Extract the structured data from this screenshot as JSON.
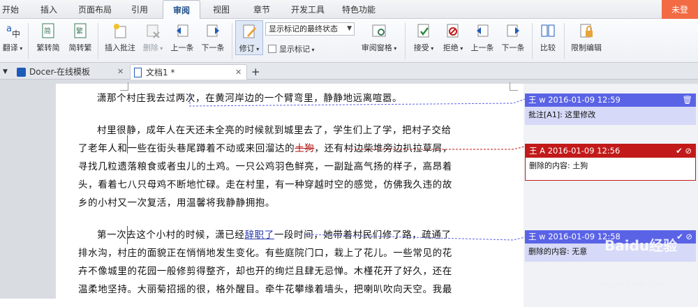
{
  "menu": {
    "tabs": [
      "开始",
      "插入",
      "页面布局",
      "引用",
      "审阅",
      "视图",
      "章节",
      "开发工具",
      "特色功能"
    ],
    "active": "审阅",
    "login": "未登"
  },
  "ribbon": {
    "translate": "翻译",
    "to_simplified": "繁转简",
    "to_traditional": "简转繁",
    "insert_comment": "插入批注",
    "delete": "删除",
    "prev": "上一条",
    "next": "下一条",
    "track": "修订",
    "display_dropdown": "显示标记的最终状态",
    "show_markup": "显示标记",
    "review_pane": "审阅窗格",
    "accept": "接受",
    "reject": "拒绝",
    "prev2": "上一条",
    "next2": "下一条",
    "compare": "比较",
    "restrict": "限制编辑"
  },
  "doc_tabs": [
    {
      "label": "Docer-在线模板"
    },
    {
      "label": "文档1 *"
    }
  ],
  "document": {
    "p1": [
      "潇那个村庄我去过两次，在黄河岸边的一个臂弯里，静静地远离喧嚣。"
    ],
    "p2": {
      "l1": "村里很静，成年人在天还未全亮的时候就到城里去了，学生们上了学，把村子交给",
      "l2_before": "了老年人和一些在街头巷尾蹲着不动或来回溜达的",
      "l2_del": "土狗",
      "l2_after": "，还有村边柴堆旁边扒拉草屑，",
      "l3": "寻找几粒遗落粮食或者虫儿的土鸡。一只公鸡羽色鲜亮，一副趾高气扬的样子，高昂着",
      "l4": "头，看着七八只母鸡不断地忙碌。走在村里，有一种穿越时空的感觉，仿佛我久违的故",
      "l5": "乡的小村又一次复活，用温馨将我静静拥抱。"
    },
    "p3": {
      "l1_before": "第一次去这个小村的时候，潇已经",
      "l1_ins": "辞职了",
      "l1_after": "一段时间，她带着村民们修了路，疏通了",
      "l2": "排水沟，村庄的面貌正在悄悄地发生变化。有些庭院门口，栽上了花儿。一些常见的花",
      "l3": "卉不像城里的花园一般修剪得整齐，却也开的绚烂且肆无忌惮。木槿花开了好久，还在",
      "l4": "温柔地坚持。大丽菊招摇的很，格外醒目。牵牛花攀缘着墙头，把喇叭吹向天空。我最"
    }
  },
  "comments": [
    {
      "author": "王 w",
      "date": "2016-01-09 12:59",
      "body": "批注[A1]: 这里修改",
      "color": "#5a63e6"
    },
    {
      "author": "王 A",
      "date": "2016-01-09 12:56",
      "body": "删除的内容: 土狗",
      "color": "#c21a1a"
    },
    {
      "author": "王 w",
      "date": "2016-01-09 12:58",
      "body": "删除的内容: 无意",
      "color": "#5a63e6"
    }
  ],
  "watermark": {
    "brand": "Baidu经验",
    "url": "jingyan.baidu.com"
  }
}
